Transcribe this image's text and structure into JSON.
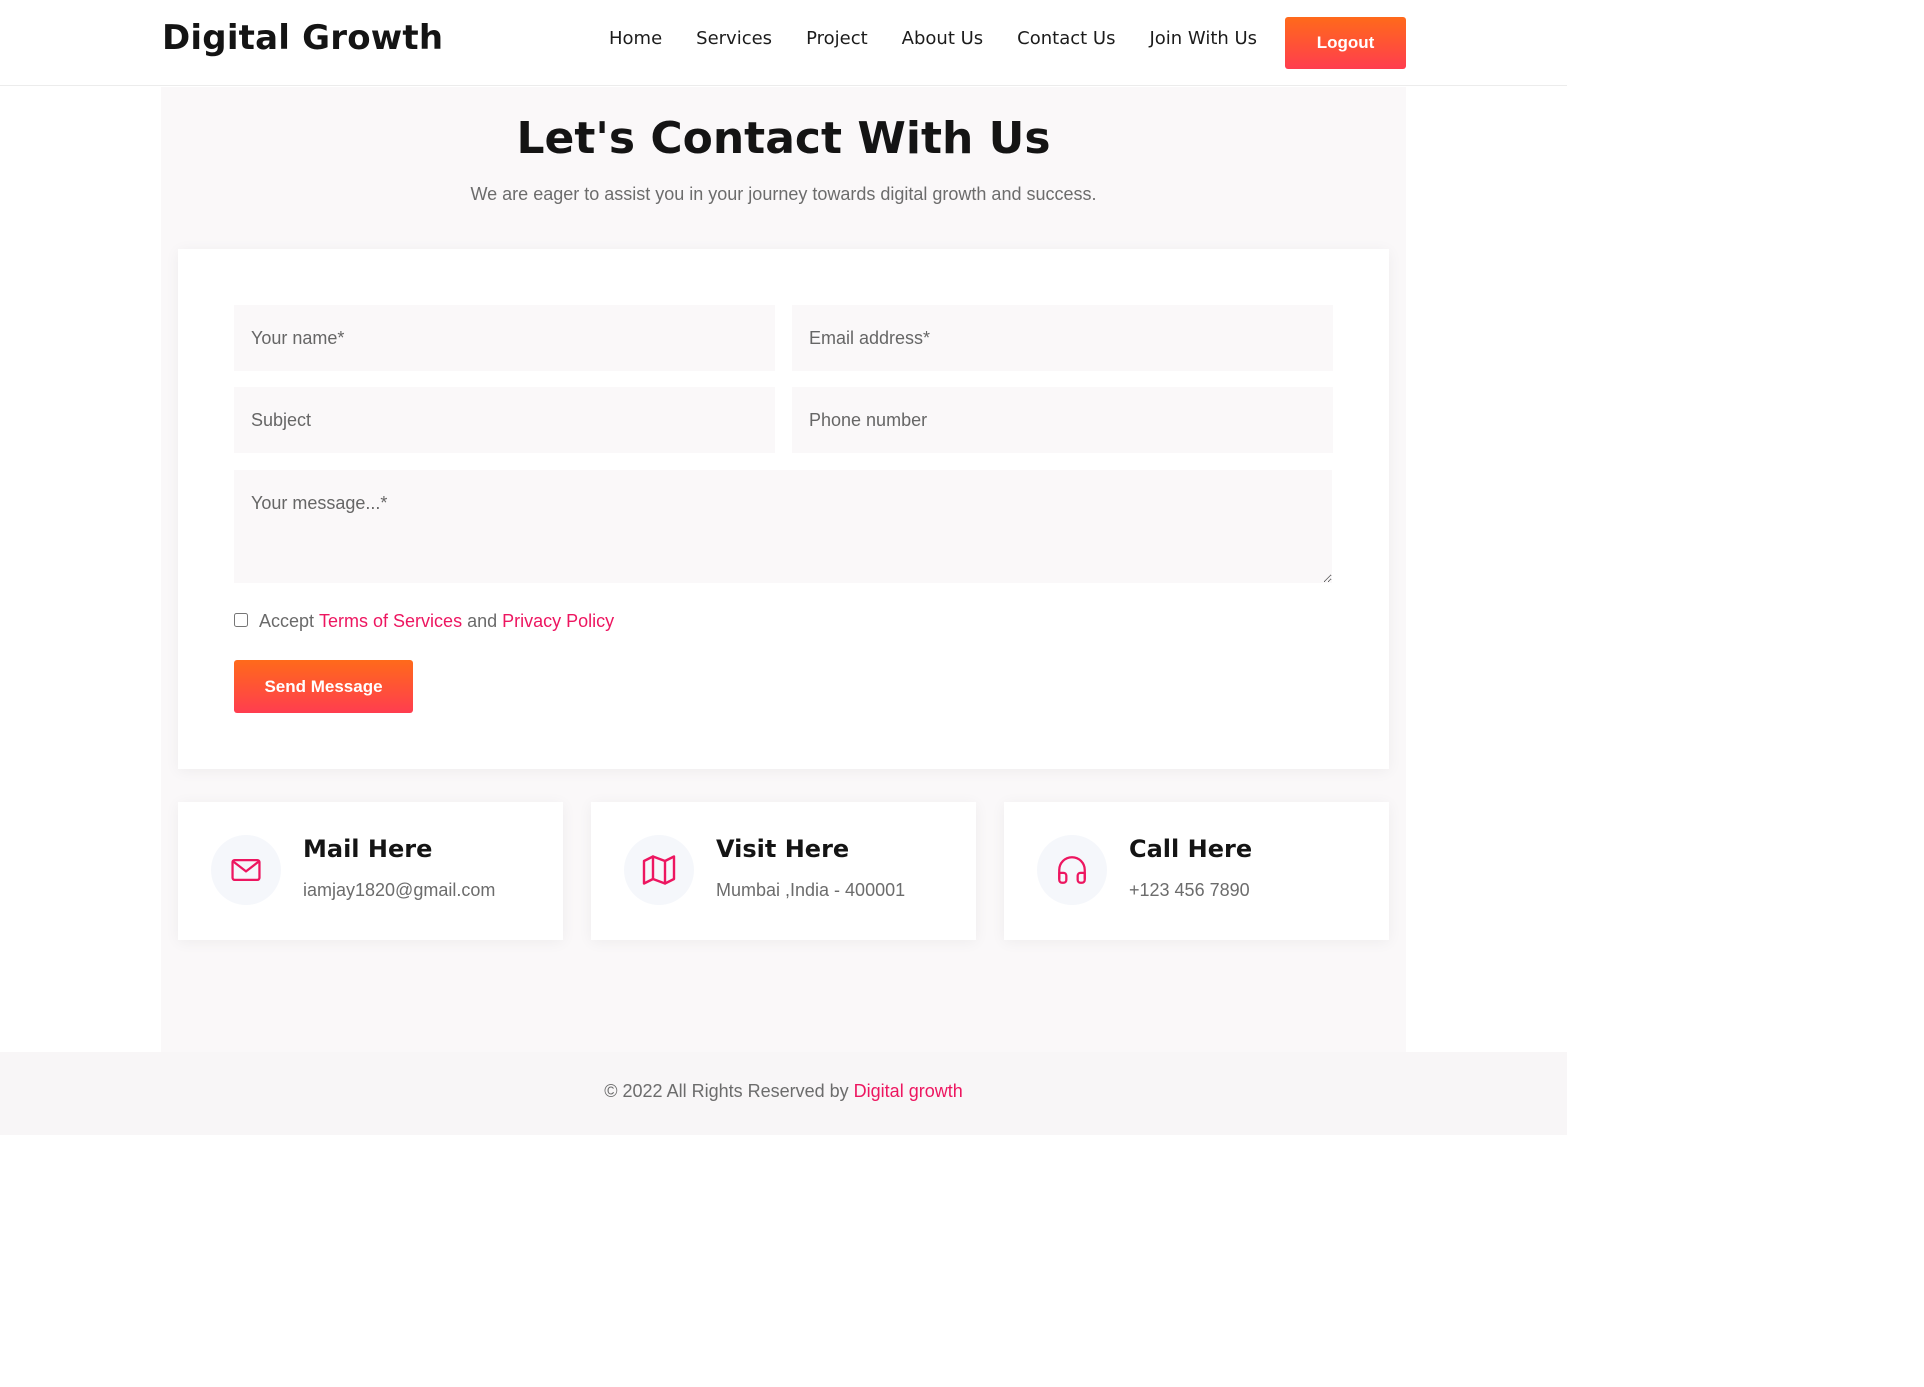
{
  "header": {
    "brand": "Digital Growth",
    "nav": [
      "Home",
      "Services",
      "Project",
      "About Us",
      "Contact Us",
      "Join With Us"
    ],
    "logout_label": "Logout"
  },
  "contact": {
    "title": "Let's Contact With Us",
    "subtitle": "We are eager to assist you in your journey towards digital growth and success."
  },
  "form": {
    "name_placeholder": "Your name*",
    "email_placeholder": "Email address*",
    "subject_placeholder": "Subject",
    "phone_placeholder": "Phone number",
    "message_placeholder": "Your message...*",
    "accept_prefix": "Accept",
    "terms_link": "Terms of Services",
    "accept_and": "and",
    "privacy_link": "Privacy Policy",
    "send_label": "Send Message"
  },
  "info_cards": [
    {
      "title": "Mail Here",
      "text": "iamjay1820@gmail.com",
      "icon": "mail-icon"
    },
    {
      "title": "Visit Here",
      "text": "Mumbai ,India - 400001",
      "icon": "map-icon"
    },
    {
      "title": "Call Here",
      "text": "+123 456 7890",
      "icon": "headphones-icon"
    }
  ],
  "footer": {
    "text": "© 2022 All Rights Reserved by",
    "link": "Digital growth"
  },
  "colors": {
    "accent_pink": "#ed1660",
    "button_gradient_top": "#ff6a1a",
    "button_gradient_bottom": "#ff3d4f"
  }
}
